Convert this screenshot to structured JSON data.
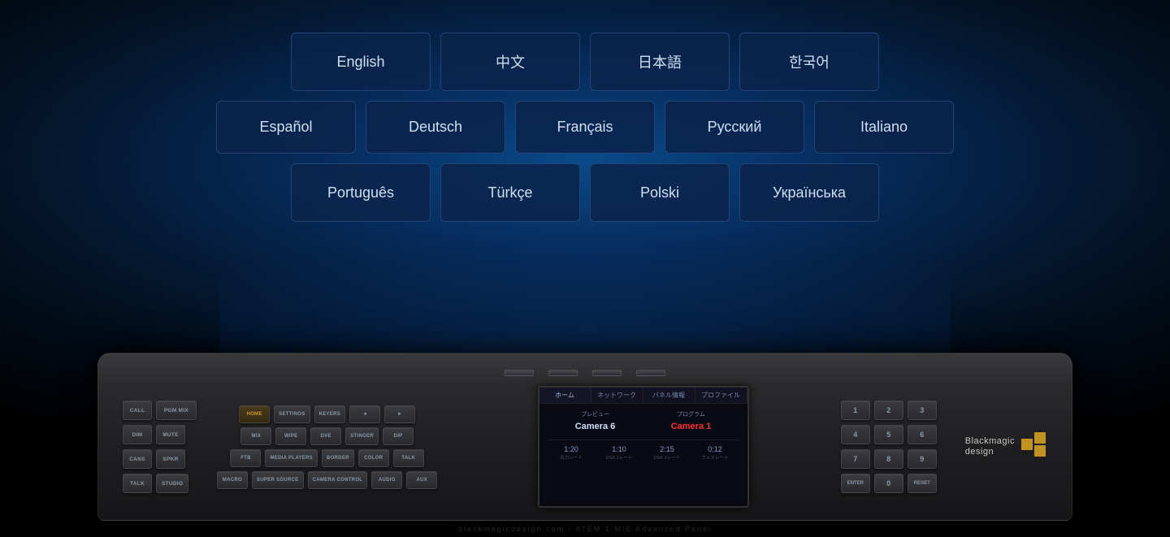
{
  "background": {
    "color_start": "#0a4a8a",
    "color_end": "#000010"
  },
  "languages": {
    "row1": [
      {
        "id": "english",
        "label": "English"
      },
      {
        "id": "chinese",
        "label": "中文"
      },
      {
        "id": "japanese",
        "label": "日本語"
      },
      {
        "id": "korean",
        "label": "한국어"
      }
    ],
    "row2": [
      {
        "id": "spanish",
        "label": "Español"
      },
      {
        "id": "german",
        "label": "Deutsch"
      },
      {
        "id": "french",
        "label": "Français"
      },
      {
        "id": "russian",
        "label": "Русский"
      },
      {
        "id": "italian",
        "label": "Italiano"
      }
    ],
    "row3": [
      {
        "id": "portuguese",
        "label": "Português"
      },
      {
        "id": "turkish",
        "label": "Türkçe"
      },
      {
        "id": "polish",
        "label": "Polski"
      },
      {
        "id": "ukrainian",
        "label": "Українська"
      }
    ]
  },
  "device": {
    "usb_ports_count": 4,
    "left_buttons": {
      "row1": [
        "CALL",
        "PGM MIX"
      ],
      "row2": [
        "DIM",
        "MUTE"
      ],
      "row3": [
        "CANS",
        "SPKR"
      ],
      "row4": [
        "TALK",
        "STUDIO"
      ]
    },
    "middle_buttons": {
      "row1": [
        "HOME",
        "SETTINGS",
        "KEYERS",
        "◄",
        "►"
      ],
      "row2": [
        "MIX",
        "WIPE",
        "DVE",
        "STINGER",
        "DIP"
      ],
      "row3": [
        "FTB",
        "MEDIA PLAYERS",
        "BORDER",
        "COLOR",
        "TALK"
      ],
      "row4": [
        "MACRO",
        "SUPER SOURCE",
        "CAMERA CONTROL",
        "AUDIO",
        "AUX"
      ]
    },
    "screen": {
      "tabs": [
        "ホーム",
        "ネットワーク",
        "パネル情報",
        "プロファイル"
      ],
      "active_tab": 0,
      "preview_label": "プレビュー",
      "preview_value": "Camera 6",
      "program_label": "プログラム",
      "program_value": "Camera 1",
      "timecodes": [
        {
          "value": "1:20",
          "label": "出力レート"
        },
        {
          "value": "1:10",
          "label": "DSK 1レート"
        },
        {
          "value": "2:15",
          "label": "DSK 2レート"
        },
        {
          "value": "0:12",
          "label": "フェスレート"
        }
      ]
    },
    "numpad": {
      "row1": [
        "1",
        "2",
        "3"
      ],
      "row2": [
        "4",
        "5",
        "6"
      ],
      "row3": [
        "7",
        "8",
        "9"
      ],
      "row4": [
        "ENTER",
        "0",
        "RESET"
      ]
    },
    "logo": {
      "text_line1": "Blackmagic",
      "text_line2": "design"
    }
  },
  "watermark": {
    "text": "blackmagicdesign.com / ATEM 1 M/E Advanced Panel"
  }
}
